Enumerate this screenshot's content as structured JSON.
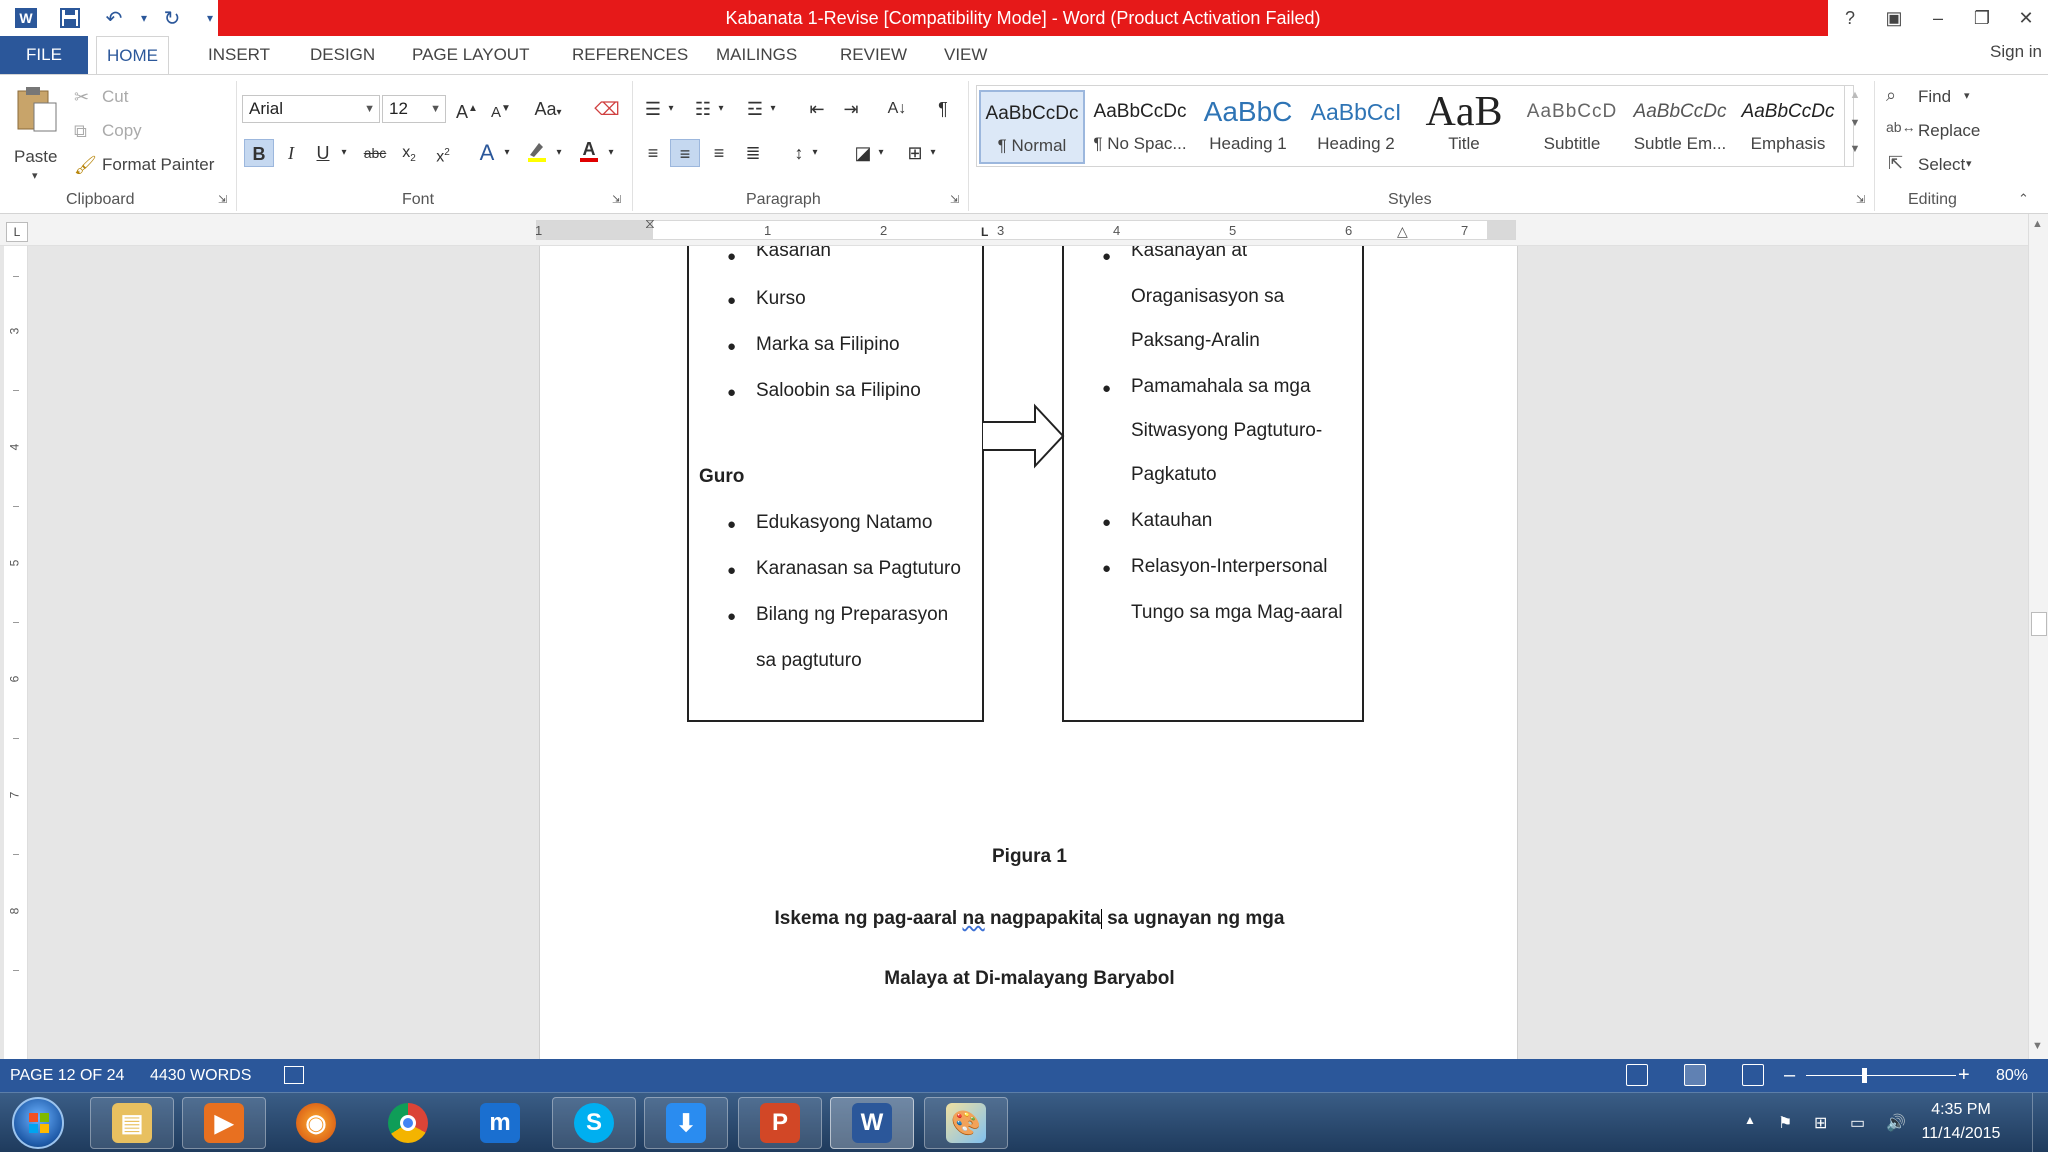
{
  "window": {
    "title": "Kabanata 1-Revise [Compatibility Mode] - Word (Product Activation Failed)",
    "qat": {
      "word_icon": "word-app-icon",
      "save": "save-icon",
      "undo": "undo-icon",
      "redo": "repeat-icon",
      "customize": "customize-qat-icon"
    },
    "controls": {
      "help": "?",
      "ribbon_display": "▣",
      "minimize": "–",
      "restore": "❐",
      "close": "✕"
    },
    "accent_color": "#2b579a",
    "title_band_color": "#e61919"
  },
  "tabs": {
    "file": "FILE",
    "home": "HOME",
    "insert": "INSERT",
    "design": "DESIGN",
    "page_layout": "PAGE LAYOUT",
    "references": "REFERENCES",
    "mailings": "MAILINGS",
    "review": "REVIEW",
    "view": "VIEW",
    "sign_in": "Sign in"
  },
  "ribbon": {
    "clipboard": {
      "label": "Clipboard",
      "paste": "Paste",
      "cut": "Cut",
      "copy": "Copy",
      "format_painter": "Format Painter"
    },
    "font": {
      "label": "Font",
      "font_name": "Arial",
      "font_size": "12",
      "change_case": "Aa",
      "strike_label": "abc"
    },
    "paragraph": {
      "label": "Paragraph"
    },
    "styles": {
      "label": "Styles",
      "items": [
        {
          "sample": "AaBbCcDc",
          "name": "¶ Normal"
        },
        {
          "sample": "AaBbCcDc",
          "name": "¶ No Spac..."
        },
        {
          "sample": "AaBbC",
          "name": "Heading 1"
        },
        {
          "sample": "AaBbCcI",
          "name": "Heading 2"
        },
        {
          "sample": "AaB",
          "name": "Title"
        },
        {
          "sample": "AaBbCcD",
          "name": "Subtitle"
        },
        {
          "sample": "AaBbCcDc",
          "name": "Subtle Em..."
        },
        {
          "sample": "AaBbCcDc",
          "name": "Emphasis"
        }
      ]
    },
    "editing": {
      "label": "Editing",
      "find": "Find",
      "replace": "Replace",
      "select": "Select"
    }
  },
  "ruler": {
    "numbers": [
      "1",
      "1",
      "2",
      "3",
      "4",
      "5",
      "6",
      "7"
    ],
    "vertical_numbers": [
      "3",
      "4",
      "5",
      "6",
      "7",
      "8"
    ],
    "tab_selector": "L"
  },
  "document": {
    "left_box_top": [
      "Kasarian",
      "Kurso",
      "Marka sa Filipino",
      "Saloobin sa Filipino"
    ],
    "guro_heading": "Guro",
    "left_box_guro": [
      "Edukasyong Natamo",
      "Karanasan sa Pagtuturo",
      "Bilang ng Preparasyon",
      "sa pagtuturo"
    ],
    "right_box": [
      "Kasanayan at",
      "Oraganisasyon sa",
      "Paksang-Aralin",
      "Pamamahala sa mga",
      "Sitwasyong Pagtuturo-",
      "Pagkatuto",
      "Katauhan",
      "Relasyon-Interpersonal",
      "Tungo sa mga Mag-aaral"
    ],
    "figure_label": "Pigura 1",
    "caption_line1_a": "Iskema ng pag-aaral ",
    "caption_line1_b": "na",
    "caption_line1_c": " nagpapakita",
    "caption_line1_d": " sa ugnayan ng mga",
    "caption_line2": "Malaya at Di-malayang Baryabol"
  },
  "status": {
    "page": "PAGE 12 OF 24",
    "words": "4430 WORDS",
    "zoom": "80%",
    "zoom_minus": "–",
    "zoom_plus": "+"
  },
  "taskbar": {
    "apps": [
      "start-button",
      "file-explorer",
      "media-player",
      "firefox",
      "chrome",
      "maxthon",
      "skype",
      "downloader",
      "powerpoint",
      "word",
      "paint"
    ],
    "time": "4:35 PM",
    "date": "11/14/2015"
  }
}
